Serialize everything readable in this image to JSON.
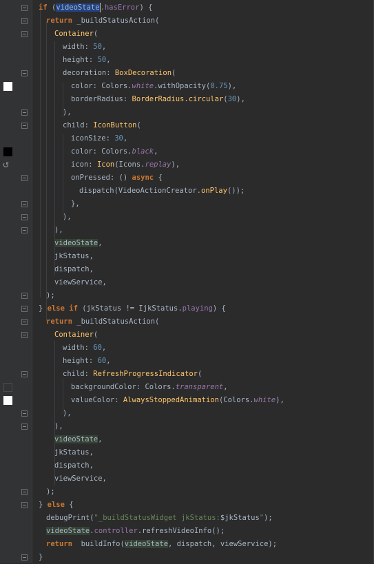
{
  "editor": {
    "lines": [
      [
        {
          "t": "if",
          "c": "kw"
        },
        {
          "t": " ("
        },
        {
          "t": "videoState",
          "c": "sel"
        },
        {
          "t": ".hasError",
          "c": "fld"
        },
        {
          "t": ") {"
        }
      ],
      [
        {
          "t": "return",
          "c": "kw"
        },
        {
          "t": " _buildStatusAction("
        }
      ],
      [
        {
          "t": "Container",
          "c": "fn"
        },
        {
          "t": "("
        }
      ],
      [
        {
          "t": "width: "
        },
        {
          "t": "50",
          "c": "num"
        },
        {
          "t": ","
        }
      ],
      [
        {
          "t": "height: "
        },
        {
          "t": "50",
          "c": "num"
        },
        {
          "t": ","
        }
      ],
      [
        {
          "t": "decoration: "
        },
        {
          "t": "BoxDecoration",
          "c": "fn"
        },
        {
          "t": "("
        }
      ],
      [
        {
          "t": "color: Colors."
        },
        {
          "t": "white",
          "c": "ifld"
        },
        {
          "t": ".withOpacity("
        },
        {
          "t": "0.75",
          "c": "num"
        },
        {
          "t": "),"
        }
      ],
      [
        {
          "t": "borderRadius: "
        },
        {
          "t": "BorderRadius.circular",
          "c": "fn"
        },
        {
          "t": "("
        },
        {
          "t": "30",
          "c": "num"
        },
        {
          "t": "),"
        }
      ],
      [
        {
          "t": "),"
        }
      ],
      [
        {
          "t": "child: "
        },
        {
          "t": "IconButton",
          "c": "fn"
        },
        {
          "t": "("
        }
      ],
      [
        {
          "t": "iconSize: "
        },
        {
          "t": "30",
          "c": "num"
        },
        {
          "t": ","
        }
      ],
      [
        {
          "t": "color: Colors."
        },
        {
          "t": "black",
          "c": "ifld"
        },
        {
          "t": ","
        }
      ],
      [
        {
          "t": "icon: "
        },
        {
          "t": "Icon",
          "c": "fn"
        },
        {
          "t": "(Icons."
        },
        {
          "t": "replay",
          "c": "ifld"
        },
        {
          "t": "),"
        }
      ],
      [
        {
          "t": "onPressed: () "
        },
        {
          "t": "async",
          "c": "kw"
        },
        {
          "t": " {"
        }
      ],
      [
        {
          "t": "dispatch(VideoActionCreator."
        },
        {
          "t": "onPlay",
          "c": "fn"
        },
        {
          "t": "());"
        }
      ],
      [
        {
          "t": "},"
        }
      ],
      [
        {
          "t": "),"
        }
      ],
      [
        {
          "t": "),"
        }
      ],
      [
        {
          "t": "videoState",
          "c": "hl"
        },
        {
          "t": ","
        }
      ],
      [
        {
          "t": "jkStatus,"
        }
      ],
      [
        {
          "t": "dispatch,"
        }
      ],
      [
        {
          "t": "viewService,"
        }
      ],
      [
        {
          "t": ");"
        }
      ],
      [
        {
          "t": "} "
        },
        {
          "t": "else if",
          "c": "kw"
        },
        {
          "t": " (jkStatus != IjkStatus."
        },
        {
          "t": "playing",
          "c": "fld"
        },
        {
          "t": ") {"
        }
      ],
      [
        {
          "t": "return",
          "c": "kw"
        },
        {
          "t": " _buildStatusAction("
        }
      ],
      [
        {
          "t": "Container",
          "c": "fn"
        },
        {
          "t": "("
        }
      ],
      [
        {
          "t": "width: "
        },
        {
          "t": "60",
          "c": "num"
        },
        {
          "t": ","
        }
      ],
      [
        {
          "t": "height: "
        },
        {
          "t": "60",
          "c": "num"
        },
        {
          "t": ","
        }
      ],
      [
        {
          "t": "child: "
        },
        {
          "t": "RefreshProgressIndicator",
          "c": "fn"
        },
        {
          "t": "("
        }
      ],
      [
        {
          "t": "backgroundColor: Colors."
        },
        {
          "t": "transparent",
          "c": "ifld"
        },
        {
          "t": ","
        }
      ],
      [
        {
          "t": "valueColor: "
        },
        {
          "t": "AlwaysStoppedAnimation",
          "c": "fn"
        },
        {
          "t": "(Colors."
        },
        {
          "t": "white",
          "c": "ifld"
        },
        {
          "t": "),"
        }
      ],
      [
        {
          "t": "),"
        }
      ],
      [
        {
          "t": "),"
        }
      ],
      [
        {
          "t": "videoState",
          "c": "hl"
        },
        {
          "t": ","
        }
      ],
      [
        {
          "t": "jkStatus,"
        }
      ],
      [
        {
          "t": "dispatch,"
        }
      ],
      [
        {
          "t": "viewService,"
        }
      ],
      [
        {
          "t": ");"
        }
      ],
      [
        {
          "t": "} "
        },
        {
          "t": "else",
          "c": "kw"
        },
        {
          "t": " {"
        }
      ],
      [
        {
          "t": "debugPrint("
        },
        {
          "t": "\"_buildStatusWidget jkStatus:",
          "c": "str"
        },
        {
          "t": "$jkStatus"
        },
        {
          "t": "\"",
          "c": "str"
        },
        {
          "t": ");"
        }
      ],
      [
        {
          "t": "videoState",
          "c": "hl"
        },
        {
          "t": "."
        },
        {
          "t": "controller",
          "c": "fld"
        },
        {
          "t": ".refreshVideoInfo();"
        }
      ],
      [
        {
          "t": "return",
          "c": "kw"
        },
        {
          "t": "  buildInfo("
        },
        {
          "t": "videoState",
          "c": "hl"
        },
        {
          "t": ", dispatch, viewService);"
        }
      ],
      [
        {
          "t": "}"
        }
      ]
    ]
  },
  "gutter": {
    "swatches": [
      {
        "color": "white",
        "line": 6
      },
      {
        "color": "black",
        "line": 11
      },
      {
        "color": "transparent",
        "line": 29
      },
      {
        "color": "white",
        "line": 30
      }
    ],
    "replay_icon": "replay-icon"
  }
}
